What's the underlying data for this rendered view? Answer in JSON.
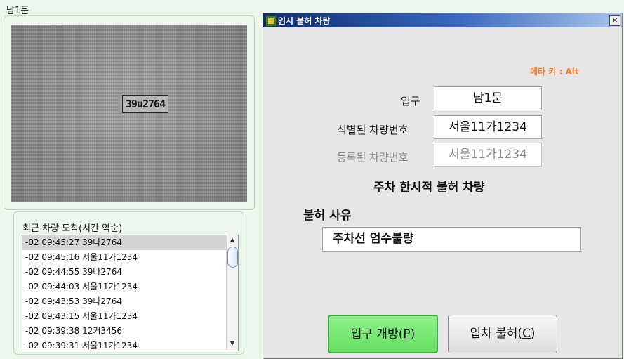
{
  "gate_title": "남1문",
  "camera": {
    "plate_text": "39u2764"
  },
  "recent": {
    "title": "최근 차량 도착(시간 역순)",
    "items": [
      "-02 09:45:27 39나2764",
      "-02 09:45:16 서울11가1234",
      "-02 09:44:55 39나2764",
      "-02 09:44:03 서울11가1234",
      "-02 09:43:53 39나2764",
      "-02 09:43:15 서울11가1234",
      "-02 09:39:38 12거3456",
      "-02 09:39:31 서울11가1234"
    ],
    "selected_index": 0
  },
  "dialog": {
    "title": "임시 불허 차량",
    "close": "×",
    "meta_key": "메타 키 : Alt",
    "entrance_label": "입구",
    "entrance_value": "남1문",
    "identified_label": "식별된 차량번호",
    "identified_value": "서울11가1234",
    "registered_label": "등록된 차량번호",
    "registered_value": "서울11가1234",
    "notice": "주차 한시적 불허 차량",
    "reason_label": "불허 사유",
    "reason_value": "주차선 엄수불량",
    "open_button": "입구 개방(",
    "open_key": "P",
    "open_suffix": ")",
    "deny_button": "입차 불허(",
    "deny_key": "C",
    "deny_suffix": ")"
  },
  "colors": {
    "meta_key": "#ff7a2c",
    "open_button": "#7be878",
    "titlebar": "#0b2b6e"
  }
}
